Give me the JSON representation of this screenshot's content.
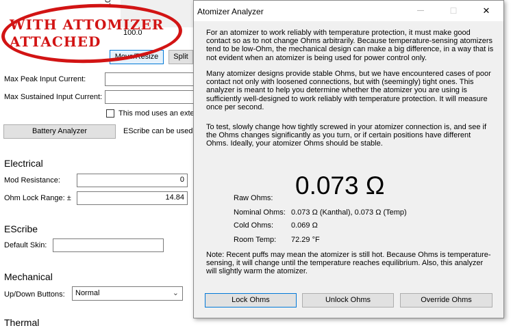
{
  "background_app": {
    "top_value": "100.0",
    "rotated_value": "100",
    "buttons": {
      "move_resize": "Move/Resize",
      "split": "Split",
      "battery_analyzer": "Battery Analyzer"
    },
    "fields": {
      "max_peak_input_current": "Max Peak Input Current:",
      "max_sustained_input_current": "Max Sustained Input Current:",
      "external_checkbox": "This mod uses an exter",
      "escribe_note": "EScribe can be used t"
    },
    "electrical": {
      "heading": "Electrical",
      "mod_resistance_label": "Mod Resistance:",
      "mod_resistance_value": "0",
      "ohm_lock_range_label": "Ohm Lock Range: ±",
      "ohm_lock_range_value": "14.84"
    },
    "escribe": {
      "heading": "EScribe",
      "default_skin_label": "Default Skin:"
    },
    "mechanical": {
      "heading": "Mechanical",
      "up_down_label": "Up/Down Buttons:",
      "up_down_value": "Normal"
    },
    "thermal": {
      "heading": "Thermal"
    },
    "annotation": {
      "line1": "WITH ATTOMIZER",
      "line2": "ATTACHED",
      "color": "#d21414"
    }
  },
  "dialog": {
    "title": "Atomizer Analyzer",
    "window_controls": {
      "minimize": "—",
      "maximize": "☐",
      "close": "✕"
    },
    "paragraphs": [
      "For an atomizer to work reliably with temperature protection, it must make good contact so as to not change Ohms arbitrarily. Because temperature-sensing atomizers tend to be low-Ohm, the mechanical design can make a big difference, in a way that is not evident when an atomizer is being used for power control only.",
      "Many atomizer designs provide stable Ohms, but we have encountered cases of poor contact not only with loosened connections, but with (seemingly) tight ones. This analyzer is meant to help you determine whether the atomizer you are using is sufficiently well-designed to work reliably with temperature protection. It will measure once per second.",
      "To test, slowly change how tightly screwed in your atomizer connection is, and see if the Ohms changes significantly as you turn, or if certain positions have different Ohms. Ideally, your atomizer Ohms should be stable."
    ],
    "readings": {
      "raw_label": "Raw Ohms:",
      "raw_value": "0.073 Ω",
      "nominal_label": "Nominal Ohms:",
      "nominal_value": "0.073 Ω (Kanthal), 0.073 Ω (Temp)",
      "cold_label": "Cold Ohms:",
      "cold_value": "0.069 Ω",
      "room_label": "Room Temp:",
      "room_value": "72.29 °F"
    },
    "note": "Note: Recent puffs may mean the atomizer is still hot. Because Ohms is temperature-sensing, it will change until the temperature reaches equilibrium. Also, this analyzer will slightly warm the atomizer.",
    "buttons": {
      "lock": "Lock Ohms",
      "unlock": "Unlock Ohms",
      "override": "Override Ohms"
    }
  }
}
